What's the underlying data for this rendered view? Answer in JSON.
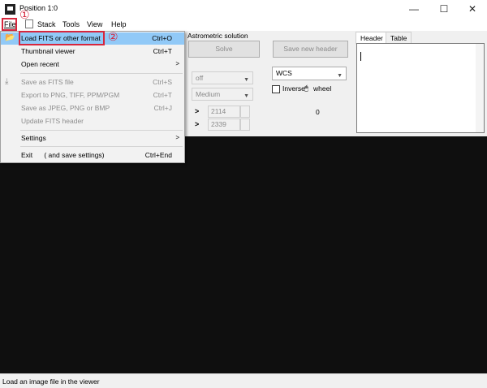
{
  "window": {
    "title": "Position 1:0",
    "controls": {
      "minimize": "—",
      "maximize": "☐",
      "close": "✕"
    }
  },
  "menubar": {
    "items": [
      "File",
      "Stack",
      "Tools",
      "View",
      "Help"
    ],
    "badges": [
      "①",
      "②"
    ]
  },
  "panel": {
    "astrometric_label": "Astrometric solution",
    "solve_button": "Solve",
    "save_header_button": "Save new header",
    "stretch_select": "off",
    "quality_select": "Medium",
    "spin_x": "2114",
    "spin_y": "2339",
    "arrow_glyph": ">",
    "coord_select": "WCS",
    "inverse_label": "Inverse",
    "mouse_glyph": "🖱",
    "wheel_label": "wheel",
    "value_zero": "0",
    "tabs": [
      "Header",
      "Table"
    ]
  },
  "file_menu": {
    "items": [
      {
        "label": "Load FITS or other format",
        "shortcut": "Ctrl+O",
        "state": "highlight"
      },
      {
        "label": "Thumbnail viewer",
        "shortcut": "Ctrl+T",
        "state": "normal"
      },
      {
        "label": "Open recent",
        "shortcut": "",
        "state": "submenu"
      },
      {
        "label": "Save as FITS file",
        "shortcut": "Ctrl+S",
        "state": "disabled"
      },
      {
        "label": "Export to PNG, TIFF, PPM/PGM",
        "shortcut": "Ctrl+T",
        "state": "disabled"
      },
      {
        "label": "Save as JPEG, PNG or BMP",
        "shortcut": "Ctrl+J",
        "state": "disabled"
      },
      {
        "label": "Update FITS header",
        "shortcut": "",
        "state": "disabled"
      },
      {
        "label": "Settings",
        "shortcut": "",
        "state": "submenu"
      },
      {
        "label": "Exit      ( and save settings)",
        "shortcut": "Ctrl+End",
        "state": "normal"
      }
    ]
  },
  "statusbar": {
    "text": "Load an image file in the viewer"
  },
  "colors": {
    "highlight": "#91c9f7",
    "annotation_red": "#d7263d",
    "viewer_bg": "#0f0f0f"
  },
  "icons": [
    "app-icon",
    "stack-icon",
    "folder-open-icon",
    "save-icon",
    "submenu-arrow-icon",
    "dropdown-arrow-icon",
    "mouse-icon"
  ]
}
